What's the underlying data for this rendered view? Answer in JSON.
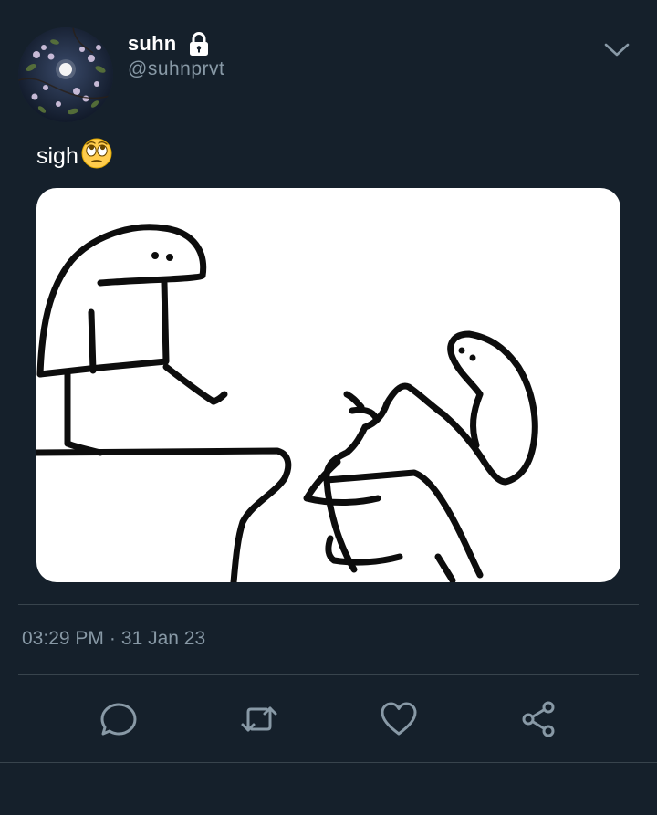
{
  "tweet": {
    "display_name": "suhn",
    "handle": "@suhnprvt",
    "text": "sigh",
    "emoji_icon": "face-with-rolling-eyes",
    "time": "03:29 PM",
    "separator": "·",
    "date": "31 Jan 23"
  },
  "icons": {
    "lock": "lock-icon",
    "more": "chevron-down-icon",
    "reply": "reply-icon",
    "retweet": "retweet-icon",
    "like": "heart-icon",
    "share": "share-icon"
  },
  "colors": {
    "background": "#15202b",
    "secondary_text": "#8899a6",
    "divider": "#38444d",
    "action_icon": "#8899a6"
  }
}
